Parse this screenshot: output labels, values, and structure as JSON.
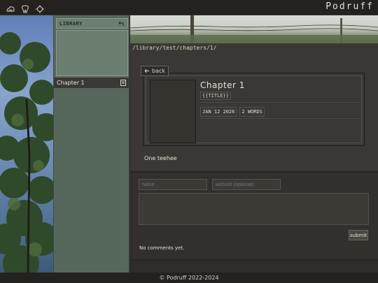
{
  "app": {
    "brand": "Podruff"
  },
  "topbar": {
    "icons": [
      "cloud-chart-icon",
      "tooth-icon",
      "crosshair-icon"
    ]
  },
  "sidebar": {
    "header_label": "LIBRARY",
    "back_icon": "return-arrow-icon",
    "items": [
      {
        "label": "Chapter 1",
        "icon": "page-icon"
      }
    ]
  },
  "main": {
    "path": "/library/test/chapters/1/",
    "back_label": "back",
    "chapter": {
      "title": "Chapter 1",
      "subtitle": "{{TITLE}}",
      "date": "JAN 12 2026",
      "words": "2 WORDS",
      "body": "One teehee"
    }
  },
  "comments": {
    "name_placeholder": "name",
    "website_placeholder": "website (optional)",
    "submit_label": "submit",
    "empty_text": "No comments yet."
  },
  "footer": {
    "text": "© Podruff 2022-2024"
  },
  "colors": {
    "sidebar": "#56685b",
    "panel": "#3a3734",
    "background": "#2a2724"
  }
}
